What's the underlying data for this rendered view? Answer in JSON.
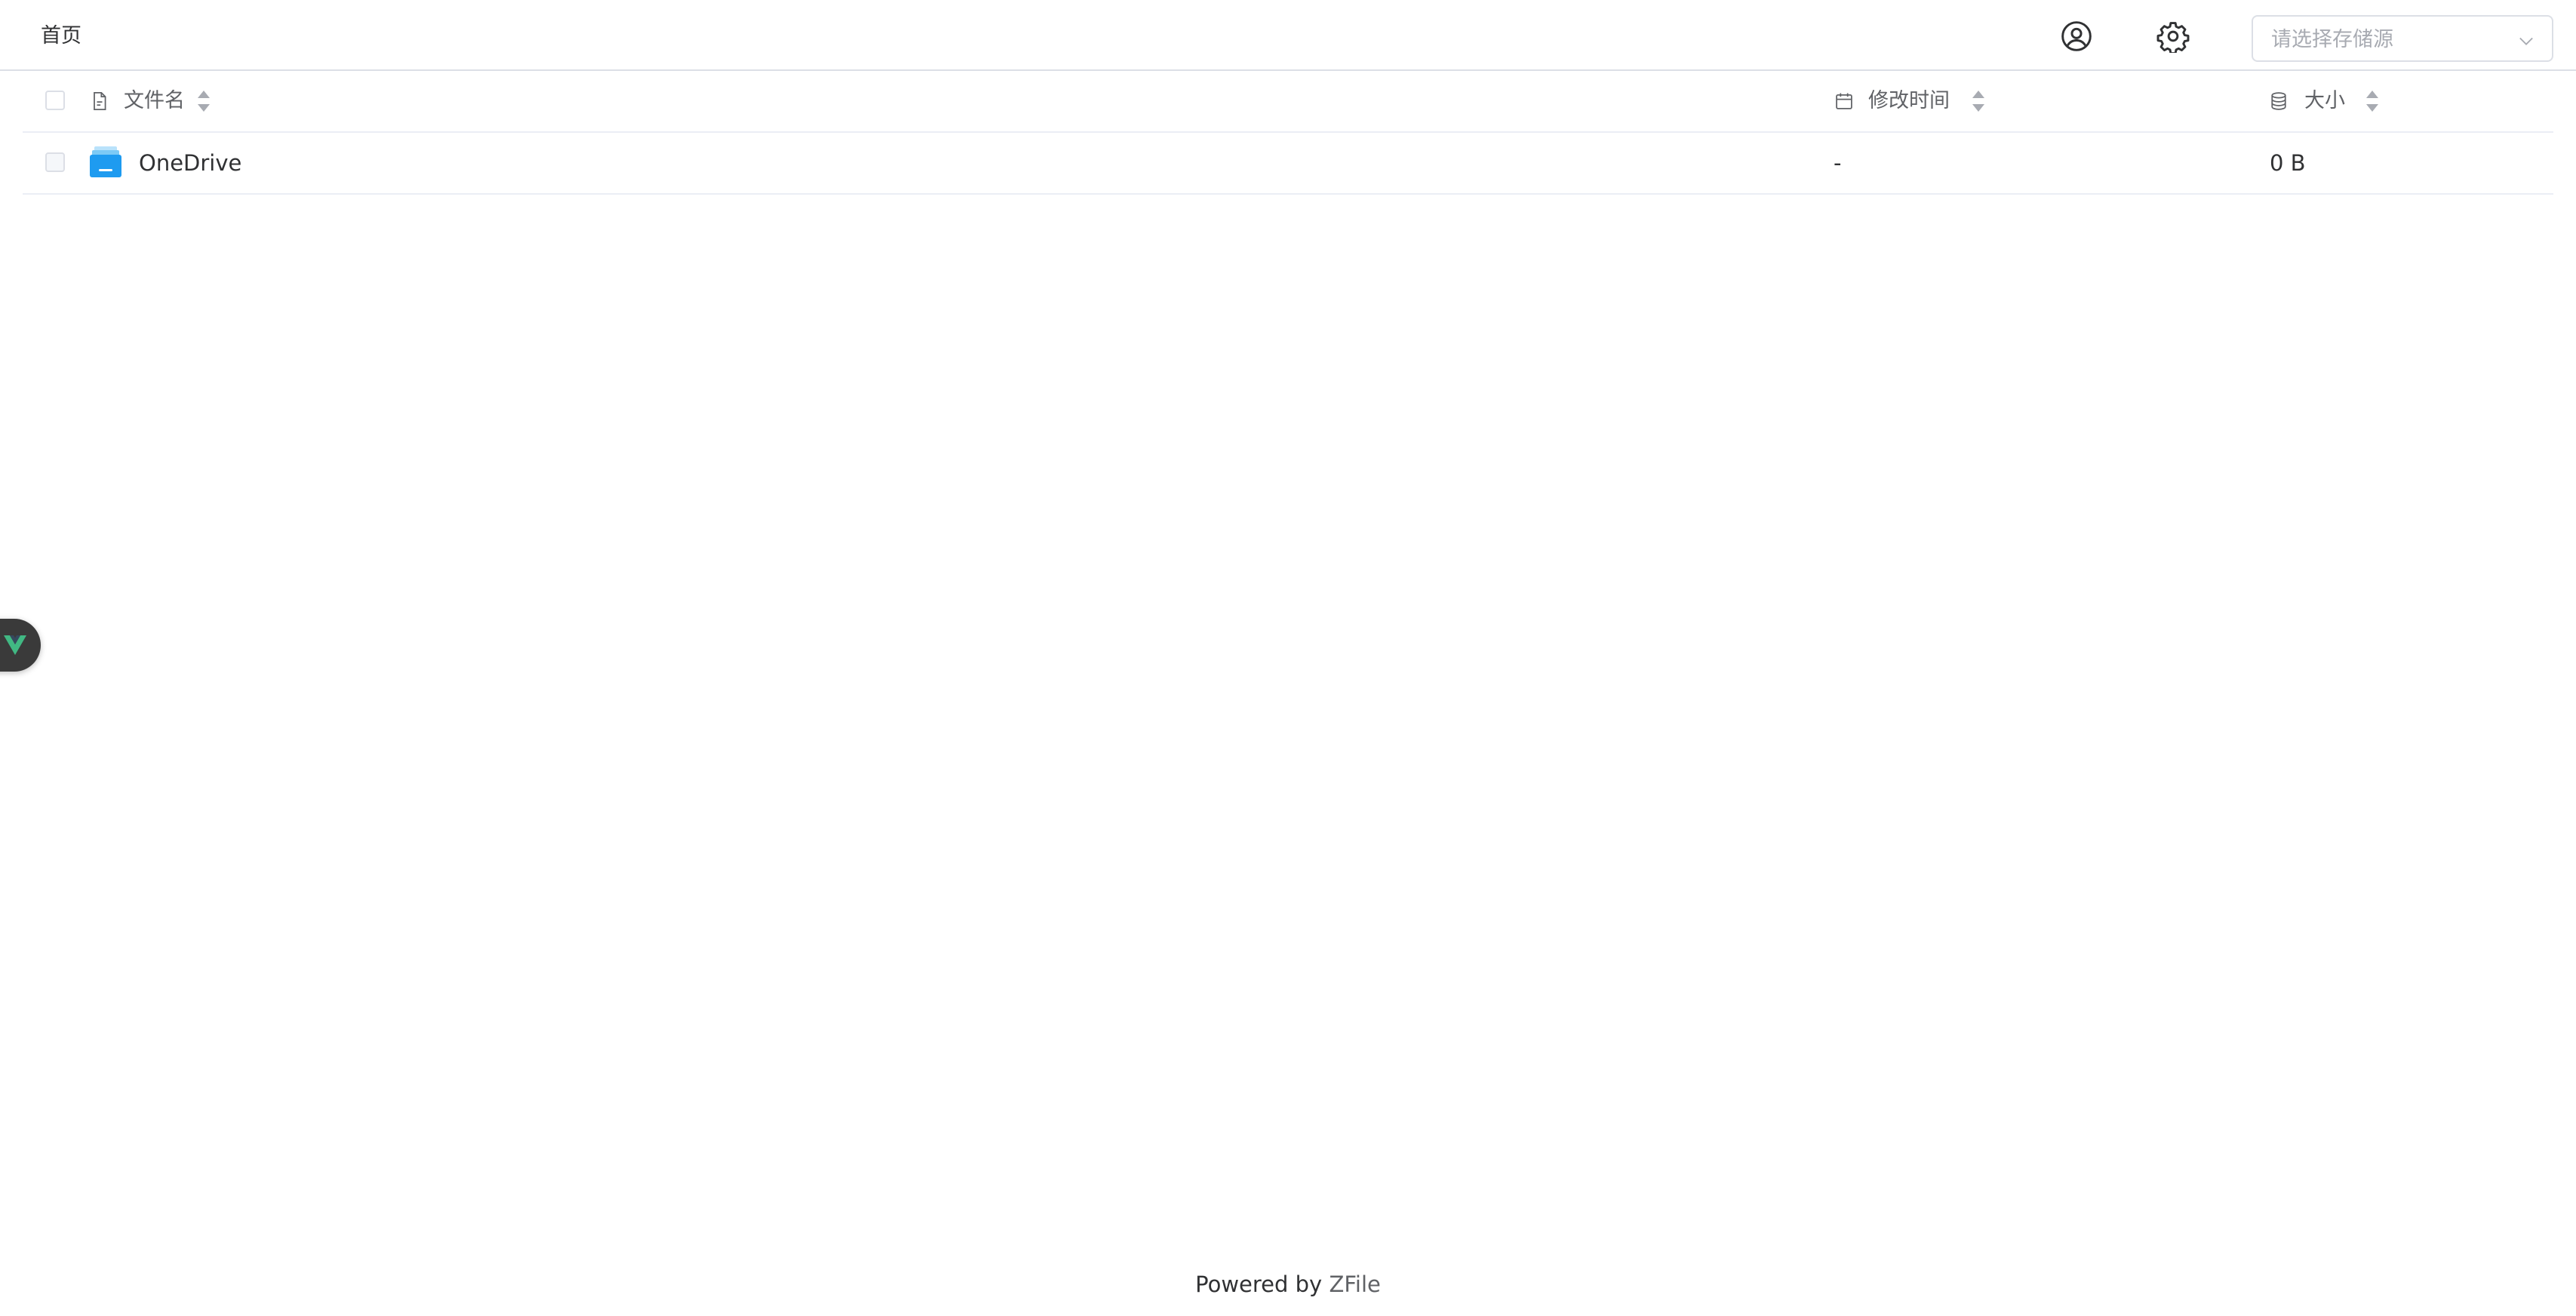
{
  "header": {
    "breadcrumb": "首页",
    "user_icon": "user-circle-icon",
    "settings_icon": "gear-icon",
    "storage_select": {
      "placeholder": "请选择存储源",
      "selected": ""
    }
  },
  "table": {
    "columns": [
      {
        "label": "文件名",
        "icon": "file-icon"
      },
      {
        "label": "修改时间",
        "icon": "calendar-icon"
      },
      {
        "label": "大小",
        "icon": "database-icon"
      }
    ],
    "rows": [
      {
        "name": "OneDrive",
        "icon": "drive-folder-icon",
        "modified": "-",
        "size": "0 B"
      }
    ]
  },
  "footer": {
    "prefix": "Powered by ",
    "brand": "ZFile"
  },
  "colors": {
    "border": "#dcdfe6",
    "row_border": "#ebeef5",
    "text": "#303133",
    "muted": "#606266",
    "placeholder": "#a8abb2",
    "folder_blue": "#1e9bf0",
    "vue_green": "#41b883"
  }
}
